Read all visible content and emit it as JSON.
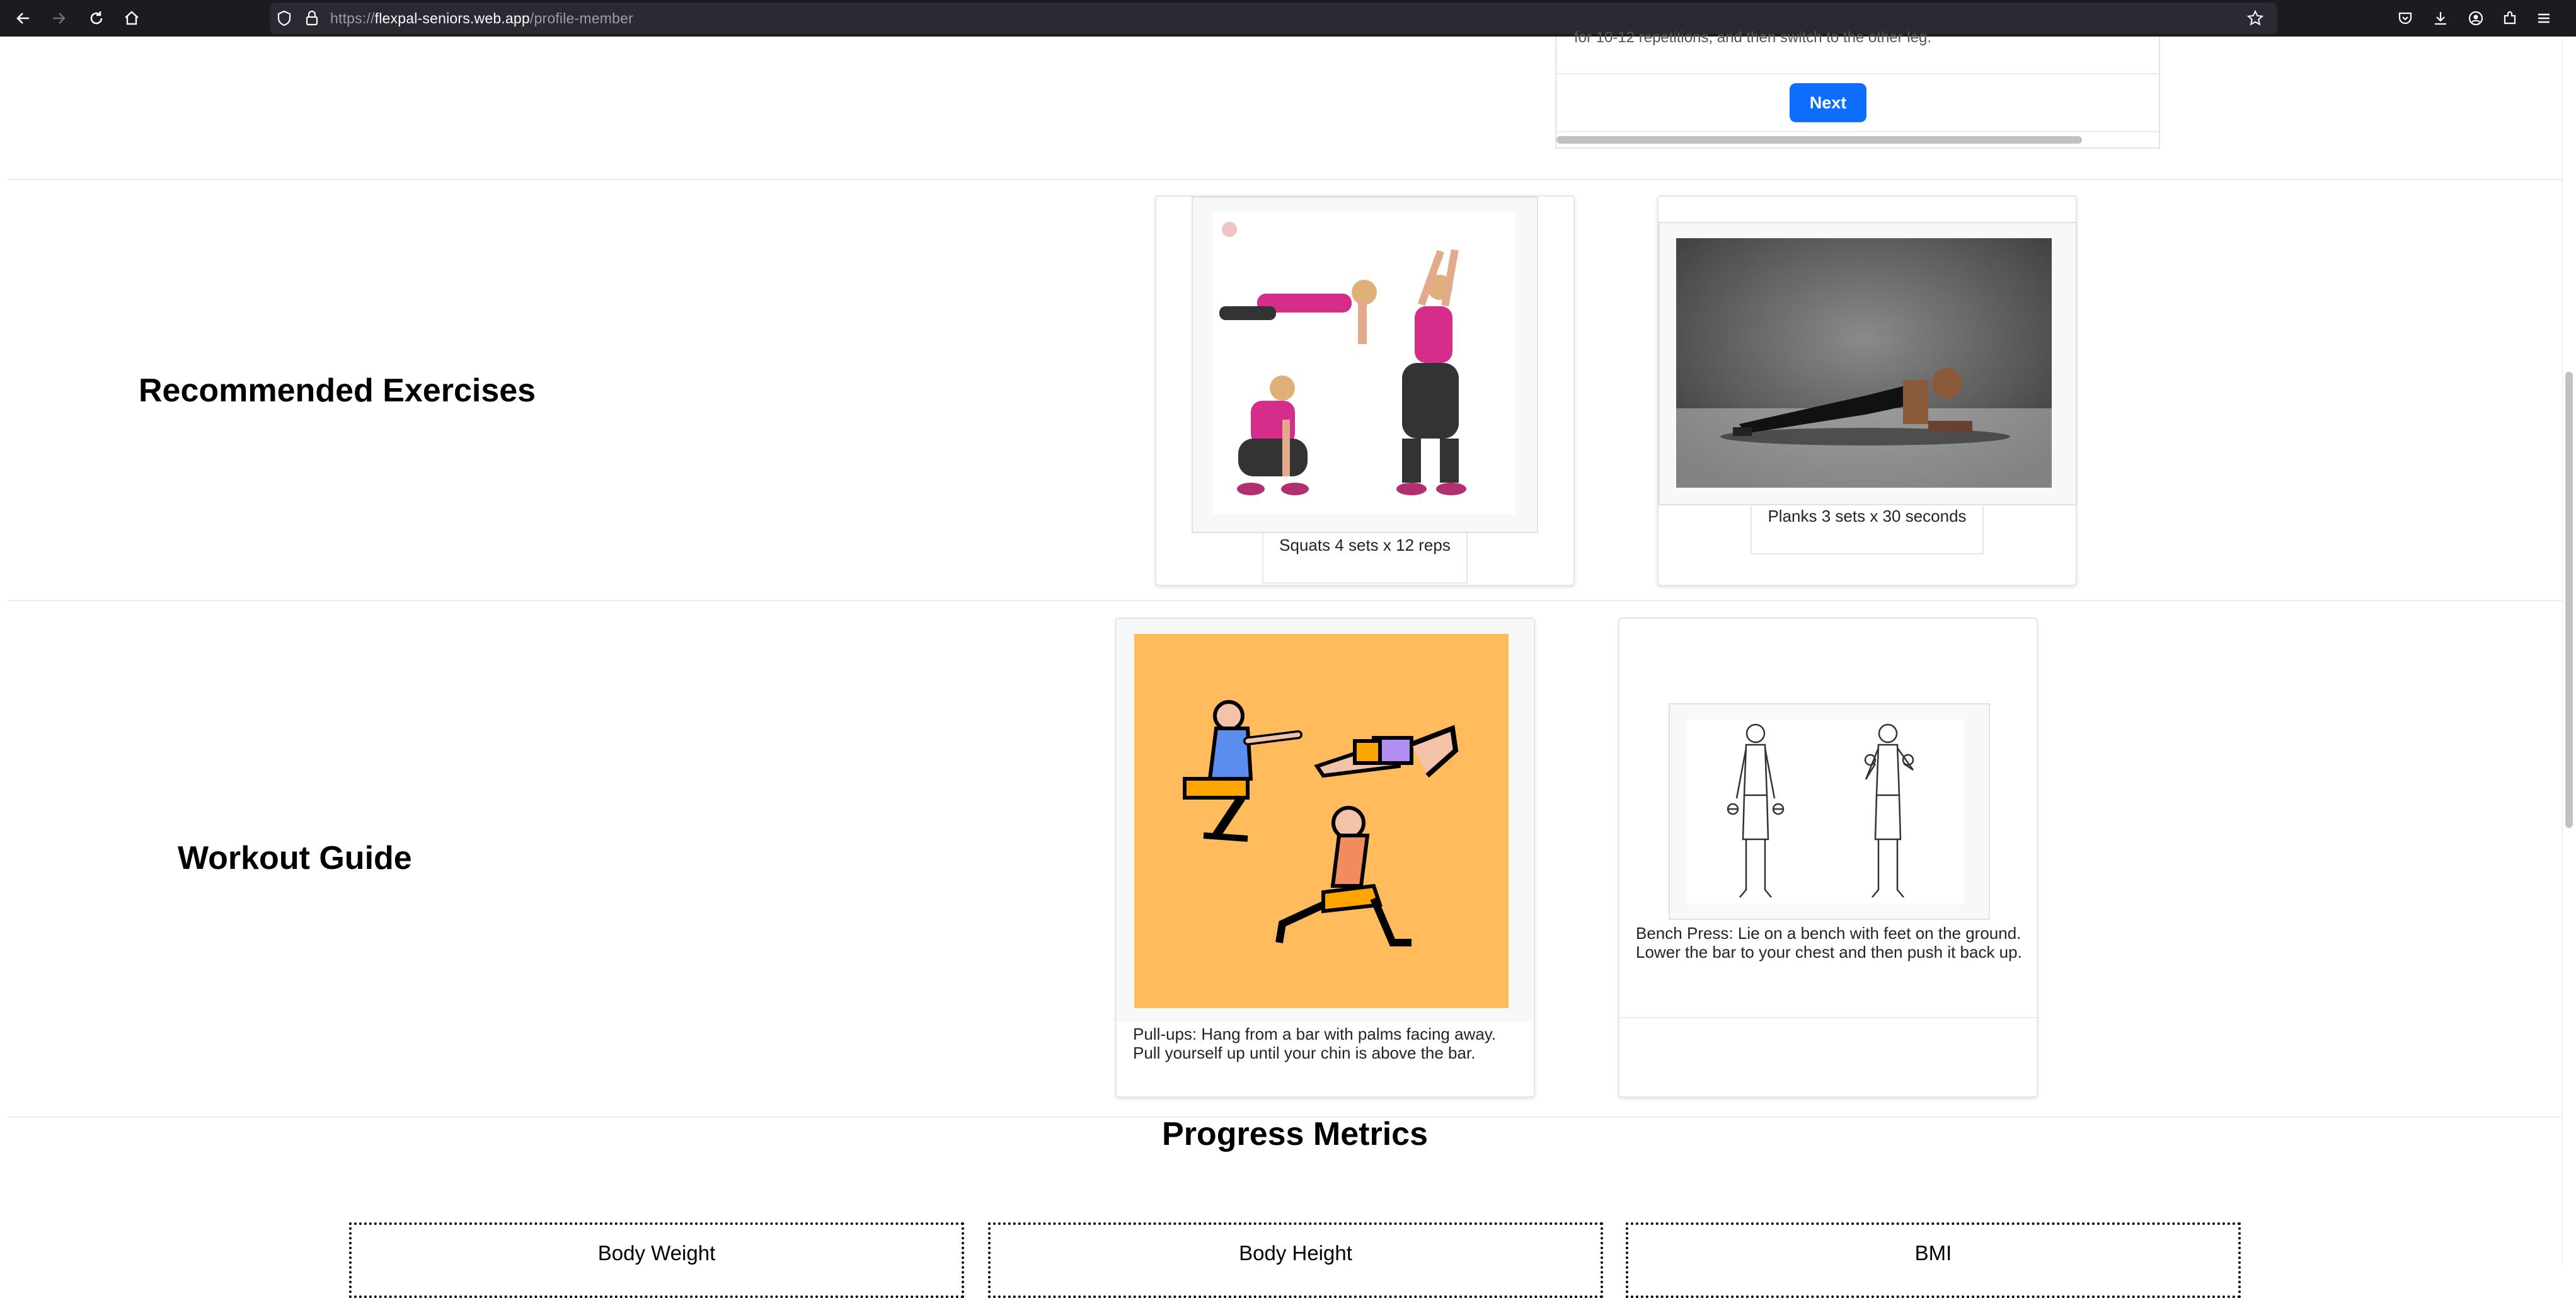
{
  "browser": {
    "url_prefix": "https://",
    "url_host": "flexpal-seniors.web.app",
    "url_path": "/profile-member",
    "icons": [
      "back-icon",
      "forward-icon",
      "reload-icon",
      "home-icon",
      "shield-icon",
      "lock-icon",
      "bookmark-star-icon",
      "pocket-icon",
      "download-icon",
      "account-icon",
      "extensions-icon",
      "menu-icon"
    ]
  },
  "carousel": {
    "clipped_text": "for 10-12 repetitions, and then switch to the other leg.",
    "next_label": "Next"
  },
  "recommended": {
    "title": "Recommended Exercises",
    "items": [
      {
        "caption": "Squats 4 sets x 12 reps",
        "image": "squat-jump-photo"
      },
      {
        "caption": "Planks 3 sets x 30 seconds",
        "image": "plank-photo"
      }
    ]
  },
  "workout_guide": {
    "title": "Workout Guide",
    "items": [
      {
        "caption": "Pull-ups: Hang from a bar with palms facing away. Pull yourself up until your chin is above the bar.",
        "image": "exercise-illustration"
      },
      {
        "caption": "Bench Press: Lie on a bench with feet on the ground. Lower the bar to your chest and then push it back up.",
        "image": "dumbbell-curl-drawing"
      }
    ]
  },
  "progress": {
    "title": "Progress Metrics",
    "metrics": [
      "Body Weight",
      "Body Height",
      "BMI"
    ]
  },
  "colors": {
    "accent": "#0d6efd",
    "illustration_bg": "#ffbb5c",
    "chrome_bg": "#1c1b22"
  }
}
